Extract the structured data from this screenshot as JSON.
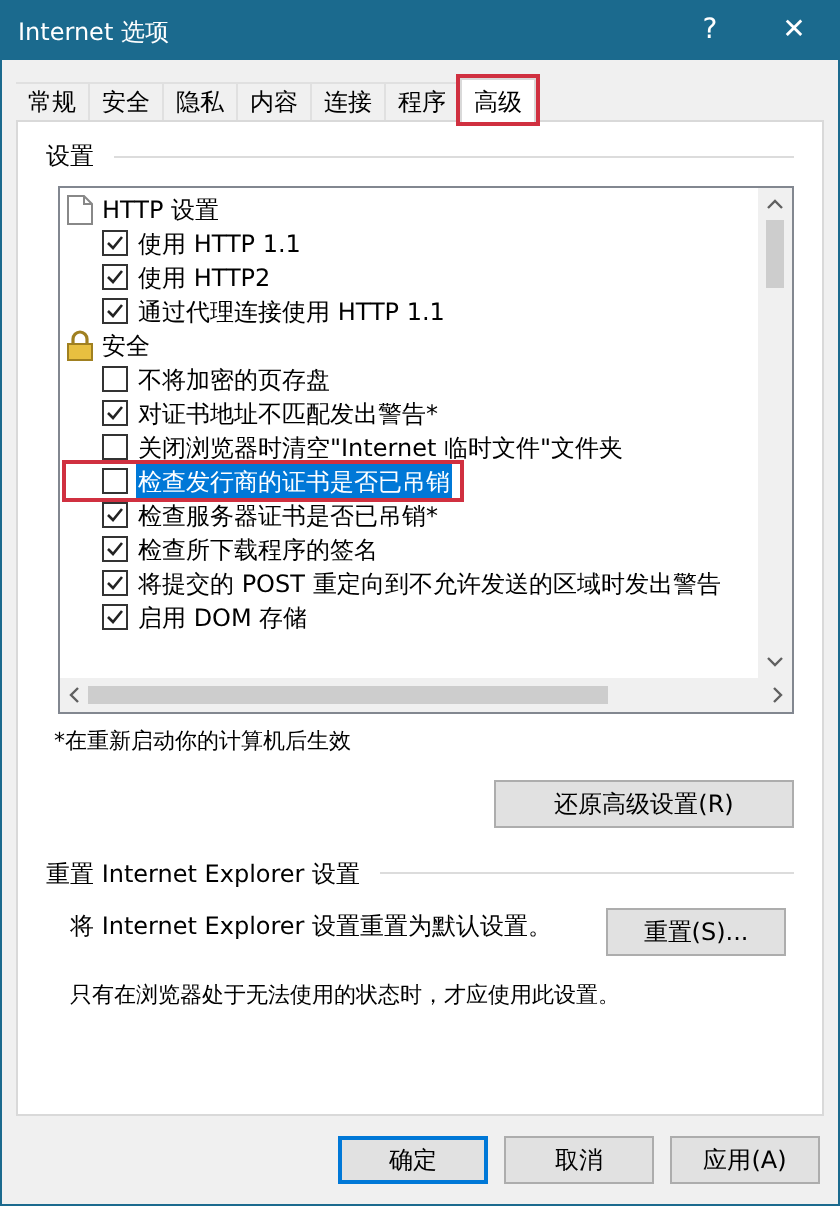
{
  "window": {
    "title": "Internet 选项",
    "help": "?",
    "close": "✕"
  },
  "tabs": [
    {
      "label": "常规",
      "selected": false,
      "outlined": false
    },
    {
      "label": "安全",
      "selected": false,
      "outlined": false
    },
    {
      "label": "隐私",
      "selected": false,
      "outlined": false
    },
    {
      "label": "内容",
      "selected": false,
      "outlined": false
    },
    {
      "label": "连接",
      "selected": false,
      "outlined": false
    },
    {
      "label": "程序",
      "selected": false,
      "outlined": false
    },
    {
      "label": "高级",
      "selected": true,
      "outlined": true
    }
  ],
  "settings": {
    "title": "设置",
    "groups": [
      {
        "label": "HTTP 设置",
        "kind": "page",
        "children": [
          {
            "label": "使用 HTTP 1.1",
            "checked": true,
            "selected": false,
            "outlined": false
          },
          {
            "label": "使用 HTTP2",
            "checked": true,
            "selected": false,
            "outlined": false
          },
          {
            "label": "通过代理连接使用 HTTP 1.1",
            "checked": true,
            "selected": false,
            "outlined": false
          }
        ]
      },
      {
        "label": "安全",
        "kind": "lock",
        "children": [
          {
            "label": "不将加密的页存盘",
            "checked": false,
            "selected": false,
            "outlined": false
          },
          {
            "label": "对证书地址不匹配发出警告*",
            "checked": true,
            "selected": false,
            "outlined": false
          },
          {
            "label": "关闭浏览器时清空\"Internet 临时文件\"文件夹",
            "checked": false,
            "selected": false,
            "outlined": false
          },
          {
            "label": "检查发行商的证书是否已吊销",
            "checked": false,
            "selected": true,
            "outlined": true
          },
          {
            "label": "检查服务器证书是否已吊销*",
            "checked": true,
            "selected": false,
            "outlined": false
          },
          {
            "label": "检查所下载程序的签名",
            "checked": true,
            "selected": false,
            "outlined": false
          },
          {
            "label": "将提交的 POST 重定向到不允许发送的区域时发出警告",
            "checked": true,
            "selected": false,
            "outlined": false
          },
          {
            "label": "启用 DOM 存储",
            "checked": true,
            "selected": false,
            "outlined": false
          }
        ]
      }
    ],
    "note": "*在重新启动你的计算机后生效",
    "restore_button": "还原高级设置(R)"
  },
  "reset": {
    "title": "重置 Internet Explorer 设置",
    "description": "将 Internet Explorer 设置重置为默认设置。",
    "button": "重置(S)...",
    "hint": "只有在浏览器处于无法使用的状态时，才应使用此设置。"
  },
  "buttons": [
    {
      "label": "确定",
      "selected": true
    },
    {
      "label": "取消",
      "selected": false
    },
    {
      "label": "应用(A)",
      "selected": false
    }
  ]
}
